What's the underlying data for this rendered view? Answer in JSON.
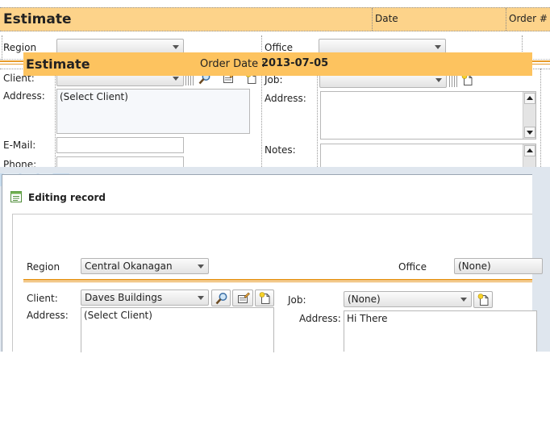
{
  "design": {
    "title": "Estimate",
    "date_label": "Date",
    "order_label": "Order #",
    "region_label": "Region",
    "office_label": "Office",
    "client_label": "Client:",
    "address_label": "Address:",
    "client_address_value": "(Select Client)",
    "email_label": "E-Mail:",
    "phone_label": "Phone:",
    "job_label": "Job:",
    "job_address_label": "Address:",
    "notes_label": "Notes:"
  },
  "dialog": {
    "window_title": "Editing record",
    "title": "Estimate",
    "order_date_label": "Order Date :",
    "order_date_value": "2013-07-05",
    "region_label": "Region",
    "region_value": "Central Okanagan",
    "office_label": "Office",
    "office_value": "(None)",
    "client_label": "Client:",
    "client_value": "Daves Buildings",
    "address_label": "Address:",
    "client_address_value": "(Select Client)",
    "job_label": "Job:",
    "job_value": "(None)",
    "job_address_label": "Address:",
    "job_address_value": "Hi There"
  },
  "colors": {
    "header_bg_design": "#fdd38a",
    "header_bg_dialog": "#fdc35f",
    "separator": "#e89c2a"
  },
  "icons": [
    "search-icon",
    "edit-record-icon",
    "new-record-icon",
    "form-window-icon"
  ]
}
